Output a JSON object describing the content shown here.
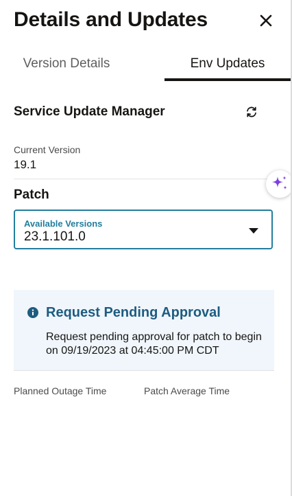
{
  "header": {
    "title": "Details and Updates",
    "close_icon": "close-icon"
  },
  "tabs": [
    {
      "label": "Version Details",
      "selected": false
    },
    {
      "label": "Env Updates",
      "selected": true
    }
  ],
  "service": {
    "title": "Service Update Manager",
    "refresh_icon": "refresh-icon",
    "current_version_label": "Current Version",
    "current_version_value": "19.1"
  },
  "patch": {
    "label": "Patch",
    "select_label": "Available Versions",
    "select_value": "23.1.101.0",
    "select_icon": "chevron-down-icon"
  },
  "notice": {
    "icon": "info-icon",
    "title": "Request Pending Approval",
    "message": "Request pending approval for patch to begin on 09/19/2023 at 04:45:00 PM CDT"
  },
  "footer": {
    "planned_outage_label": "Planned Outage Time",
    "patch_average_label": "Patch Average Time"
  },
  "colors": {
    "accent": "#227e9e",
    "notice_bg": "#f0f6fb",
    "notice_title": "#1d5c80",
    "ai_sparkle": "#7b3fe4"
  }
}
